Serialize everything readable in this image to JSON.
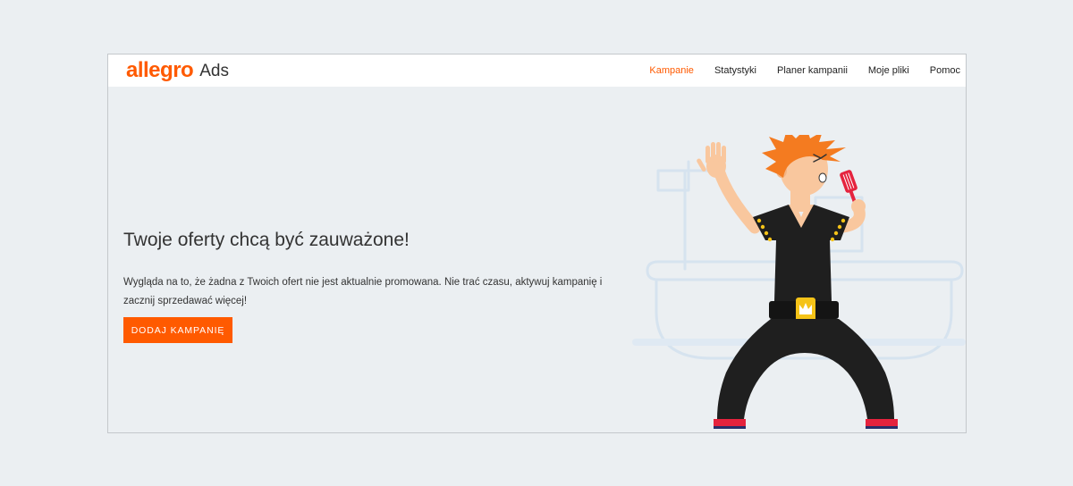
{
  "logo": {
    "brand": "allegro",
    "product": "Ads"
  },
  "nav": {
    "items": [
      {
        "label": "Kampanie",
        "active": true
      },
      {
        "label": "Statystyki",
        "active": false
      },
      {
        "label": "Planer kampanii",
        "active": false
      },
      {
        "label": "Moje pliki",
        "active": false
      },
      {
        "label": "Pomoc",
        "active": false
      }
    ]
  },
  "main": {
    "headline": "Twoje oferty chcą być zauważone!",
    "description": "Wygląda na to, że żadna z Twoich ofert nie jest aktualnie promowana. Nie trać czasu, aktywuj kampanię i zacznij sprzedawać więcej!",
    "cta_label": "DODAJ KAMPANIĘ"
  },
  "colors": {
    "accent": "#ff5a00",
    "background": "#ebeff2",
    "text": "#333333"
  },
  "icons": {
    "illustration": "singing-rocker-illustration"
  }
}
